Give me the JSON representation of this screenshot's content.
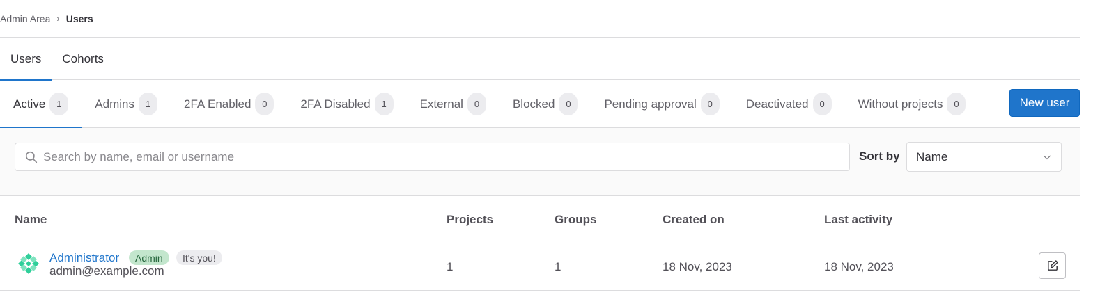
{
  "breadcrumb": {
    "parent": "Admin Area",
    "current": "Users"
  },
  "top_tabs": [
    {
      "label": "Users",
      "active": true
    },
    {
      "label": "Cohorts",
      "active": false
    }
  ],
  "filter_tabs": [
    {
      "label": "Active",
      "count": "1",
      "active": true
    },
    {
      "label": "Admins",
      "count": "1",
      "active": false
    },
    {
      "label": "2FA Enabled",
      "count": "0",
      "active": false
    },
    {
      "label": "2FA Disabled",
      "count": "1",
      "active": false
    },
    {
      "label": "External",
      "count": "0",
      "active": false
    },
    {
      "label": "Blocked",
      "count": "0",
      "active": false
    },
    {
      "label": "Pending approval",
      "count": "0",
      "active": false
    },
    {
      "label": "Deactivated",
      "count": "0",
      "active": false
    },
    {
      "label": "Without projects",
      "count": "0",
      "active": false
    }
  ],
  "new_user_button": "New user",
  "search": {
    "placeholder": "Search by name, email or username",
    "value": ""
  },
  "sort": {
    "label": "Sort by",
    "selected": "Name"
  },
  "table": {
    "headers": {
      "name": "Name",
      "projects": "Projects",
      "groups": "Groups",
      "created": "Created on",
      "activity": "Last activity"
    },
    "rows": [
      {
        "name": "Administrator",
        "admin_badge": "Admin",
        "you_badge": "It's you!",
        "email": "admin@example.com",
        "projects": "1",
        "groups": "1",
        "created": "18 Nov, 2023",
        "activity": "18 Nov, 2023"
      }
    ]
  },
  "colors": {
    "accent": "#1f75cb",
    "admin_badge_bg": "#c3e6cd",
    "avatar": "#2fcf9a"
  },
  "icons": {
    "search": "search-icon",
    "sort": "chevron-down-icon",
    "edit": "pencil-square-icon",
    "breadcrumb_separator": "chevron-right-icon"
  }
}
